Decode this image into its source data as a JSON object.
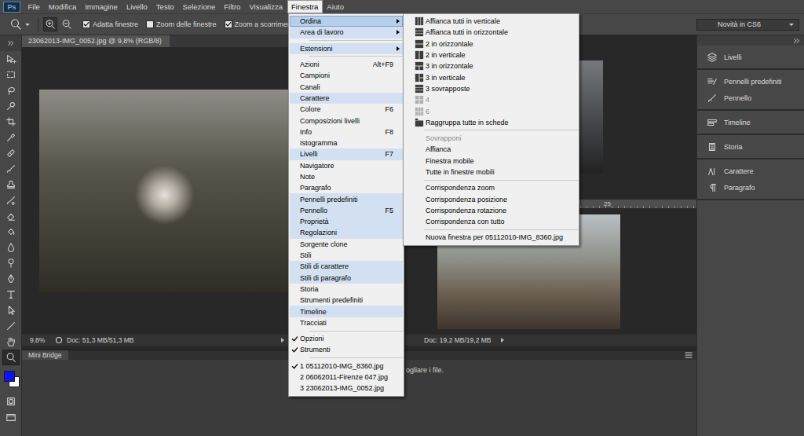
{
  "logo": "Ps",
  "menubar": [
    {
      "label": "File",
      "selected": false
    },
    {
      "label": "Modifica",
      "selected": false
    },
    {
      "label": "Immagine",
      "selected": false
    },
    {
      "label": "Livello",
      "selected": false
    },
    {
      "label": "Testo",
      "selected": false
    },
    {
      "label": "Selezione",
      "selected": false
    },
    {
      "label": "Filtro",
      "selected": false
    },
    {
      "label": "Visualizza",
      "selected": false
    },
    {
      "label": "Finestra",
      "selected": true
    },
    {
      "label": "Aiuto",
      "selected": false
    }
  ],
  "options_bar": {
    "zoom_buttons": [
      {
        "kind": "zoom-in",
        "selected": true
      },
      {
        "kind": "zoom-out",
        "selected": false
      }
    ],
    "checkboxes": [
      {
        "label": "Adatta finestre",
        "checked": true
      },
      {
        "label": "Zoom delle finestre",
        "checked": false
      },
      {
        "label": "Zoom a scorrimento",
        "checked": true
      }
    ],
    "workspace": "Novità in CS6"
  },
  "tools": [
    {
      "selected": false
    },
    {
      "selected": false
    },
    {
      "selected": false
    },
    {
      "selected": false
    },
    {
      "selected": false
    },
    {
      "selected": false
    },
    {
      "selected": false
    },
    {
      "selected": false
    },
    {
      "selected": false
    },
    {
      "selected": false
    },
    {
      "selected": false
    },
    {
      "selected": false
    },
    {
      "selected": false
    },
    {
      "selected": false
    },
    {
      "selected": false
    },
    {
      "selected": false
    },
    {
      "selected": false
    },
    {
      "selected": false
    },
    {
      "selected": false
    },
    {
      "selected": true
    }
  ],
  "swatches": [
    {
      "kind": "foreground",
      "color": "#0a14f5"
    },
    {
      "kind": "background",
      "color": "#ffffff"
    }
  ],
  "main_document": {
    "tab": "23062013-IMG_0052.jpg @ 9,8% (RGB/8)",
    "tab_selected": true,
    "zoom": "9,8%",
    "status": "Doc: 51,3 MB/51,3 MB"
  },
  "bottom_document": {
    "ruler_labels": [
      "25"
    ],
    "status": "Doc: 19,2 MB/19,2 MB"
  },
  "mini_bridge": {
    "title": "Mini Bridge",
    "message": "ogliare i file."
  },
  "dock": [
    {
      "items": [
        {
          "label": "Livelli"
        }
      ]
    },
    {
      "items": [
        {
          "label": "Pennelli predefiniti"
        },
        {
          "label": "Pennello"
        }
      ]
    },
    {
      "items": [
        {
          "label": "Timeline"
        }
      ]
    },
    {
      "items": [
        {
          "label": "Storia"
        }
      ]
    },
    {
      "items": [
        {
          "label": "Carattere"
        },
        {
          "label": "Paragrafo"
        }
      ]
    }
  ],
  "window_menu": {
    "items": [
      {
        "kind": "item",
        "label": "Ordina",
        "submenu": true,
        "checked": false,
        "highlighted": true,
        "selected": true
      },
      {
        "kind": "item",
        "label": "Area di lavoro",
        "submenu": true,
        "checked": false,
        "highlighted": true,
        "selected": false
      },
      {
        "kind": "separator"
      },
      {
        "kind": "item",
        "label": "Estensioni",
        "submenu": true,
        "checked": false,
        "highlighted": true,
        "selected": false
      },
      {
        "kind": "separator"
      },
      {
        "kind": "item",
        "label": "Azioni",
        "shortcut": "Alt+F9",
        "submenu": false,
        "checked": false,
        "highlighted": false,
        "selected": false
      },
      {
        "kind": "item",
        "label": "Campioni",
        "submenu": false,
        "checked": false,
        "highlighted": false,
        "selected": false
      },
      {
        "kind": "item",
        "label": "Canali",
        "submenu": false,
        "checked": false,
        "highlighted": false,
        "selected": false
      },
      {
        "kind": "item",
        "label": "Carattere",
        "submenu": false,
        "checked": false,
        "highlighted": true,
        "selected": false
      },
      {
        "kind": "item",
        "label": "Colore",
        "shortcut": "F6",
        "submenu": false,
        "checked": false,
        "highlighted": false,
        "selected": false
      },
      {
        "kind": "item",
        "label": "Composizioni livelli",
        "submenu": false,
        "checked": false,
        "highlighted": false,
        "selected": false
      },
      {
        "kind": "item",
        "label": "Info",
        "shortcut": "F8",
        "submenu": false,
        "checked": false,
        "highlighted": false,
        "selected": false
      },
      {
        "kind": "item",
        "label": "Istogramma",
        "submenu": false,
        "checked": false,
        "highlighted": false,
        "selected": false
      },
      {
        "kind": "item",
        "label": "Livelli",
        "shortcut": "F7",
        "submenu": false,
        "checked": false,
        "highlighted": true,
        "selected": false
      },
      {
        "kind": "item",
        "label": "Navigatore",
        "submenu": false,
        "checked": false,
        "highlighted": false,
        "selected": false
      },
      {
        "kind": "item",
        "label": "Note",
        "submenu": false,
        "checked": false,
        "highlighted": false,
        "selected": false
      },
      {
        "kind": "item",
        "label": "Paragrafo",
        "submenu": false,
        "checked": false,
        "highlighted": false,
        "selected": false
      },
      {
        "kind": "item",
        "label": "Pennelli predefiniti",
        "submenu": false,
        "checked": false,
        "highlighted": true,
        "selected": false
      },
      {
        "kind": "item",
        "label": "Pennello",
        "shortcut": "F5",
        "submenu": false,
        "checked": false,
        "highlighted": true,
        "selected": false
      },
      {
        "kind": "item",
        "label": "Proprietà",
        "submenu": false,
        "checked": false,
        "highlighted": true,
        "selected": false
      },
      {
        "kind": "item",
        "label": "Regolazioni",
        "submenu": false,
        "checked": false,
        "highlighted": true,
        "selected": false
      },
      {
        "kind": "item",
        "label": "Sorgente clone",
        "submenu": false,
        "checked": false,
        "highlighted": false,
        "selected": false
      },
      {
        "kind": "item",
        "label": "Stili",
        "submenu": false,
        "checked": false,
        "highlighted": false,
        "selected": false
      },
      {
        "kind": "item",
        "label": "Stili di carattere",
        "submenu": false,
        "checked": false,
        "highlighted": true,
        "selected": false
      },
      {
        "kind": "item",
        "label": "Stili di paragrafo",
        "submenu": false,
        "checked": false,
        "highlighted": true,
        "selected": false
      },
      {
        "kind": "item",
        "label": "Storia",
        "submenu": false,
        "checked": false,
        "highlighted": false,
        "selected": false
      },
      {
        "kind": "item",
        "label": "Strumenti predefiniti",
        "submenu": false,
        "checked": false,
        "highlighted": false,
        "selected": false
      },
      {
        "kind": "item",
        "label": "Timeline",
        "submenu": false,
        "checked": false,
        "highlighted": true,
        "selected": false
      },
      {
        "kind": "item",
        "label": "Tracciati",
        "submenu": false,
        "checked": false,
        "highlighted": false,
        "selected": false
      },
      {
        "kind": "separator"
      },
      {
        "kind": "item",
        "label": "Opzioni",
        "submenu": false,
        "checked": true,
        "highlighted": false,
        "selected": false
      },
      {
        "kind": "item",
        "label": "Strumenti",
        "submenu": false,
        "checked": true,
        "highlighted": false,
        "selected": false
      },
      {
        "kind": "separator"
      },
      {
        "kind": "item",
        "label": "1 05112010-IMG_8360.jpg",
        "submenu": false,
        "checked": true,
        "highlighted": false,
        "selected": false
      },
      {
        "kind": "item",
        "label": "2 06062011-Firenze 047.jpg",
        "submenu": false,
        "checked": false,
        "highlighted": false,
        "selected": false
      },
      {
        "kind": "item",
        "label": "3 23062013-IMG_0052.jpg",
        "submenu": false,
        "checked": false,
        "highlighted": false,
        "selected": false
      }
    ]
  },
  "arrange_submenu": {
    "items": [
      {
        "kind": "layout",
        "label": "Affianca tutti in verticale",
        "disabled": false,
        "selected": false
      },
      {
        "kind": "layout",
        "label": "Affianca tutti in orizzontale",
        "disabled": false,
        "selected": false
      },
      {
        "kind": "layout",
        "label": "2 in orizzontale",
        "disabled": false,
        "selected": false
      },
      {
        "kind": "layout",
        "label": "2 in verticale",
        "disabled": false,
        "selected": false
      },
      {
        "kind": "layout",
        "label": "3 in orizzontale",
        "disabled": false,
        "selected": false
      },
      {
        "kind": "layout",
        "label": "3 in verticale",
        "disabled": false,
        "selected": false
      },
      {
        "kind": "layout",
        "label": "3 sovrapposte",
        "disabled": false,
        "selected": false
      },
      {
        "kind": "layout",
        "label": "4",
        "disabled": true,
        "selected": false
      },
      {
        "kind": "layout",
        "label": "6",
        "disabled": true,
        "selected": false
      },
      {
        "kind": "layout",
        "label": "Raggruppa tutte in schede",
        "disabled": false,
        "selected": false
      },
      {
        "kind": "separator"
      },
      {
        "kind": "item",
        "label": "Sovrapponi",
        "disabled": true,
        "selected": false
      },
      {
        "kind": "item",
        "label": "Affianca",
        "disabled": false,
        "selected": false
      },
      {
        "kind": "item",
        "label": "Finestra mobile",
        "disabled": false,
        "selected": false
      },
      {
        "kind": "item",
        "label": "Tutte in finestre mobili",
        "disabled": false,
        "selected": false
      },
      {
        "kind": "separator"
      },
      {
        "kind": "item",
        "label": "Corrispondenza zoom",
        "disabled": false,
        "selected": false
      },
      {
        "kind": "item",
        "label": "Corrispondenza posizione",
        "disabled": false,
        "selected": false
      },
      {
        "kind": "item",
        "label": "Corrispondenza rotazione",
        "disabled": false,
        "selected": false
      },
      {
        "kind": "item",
        "label": "Corrispondenza con tutto",
        "disabled": false,
        "selected": false
      },
      {
        "kind": "separator"
      },
      {
        "kind": "item",
        "label": "Nuova finestra per 05112010-IMG_8360.jpg",
        "disabled": false,
        "selected": false
      }
    ]
  }
}
